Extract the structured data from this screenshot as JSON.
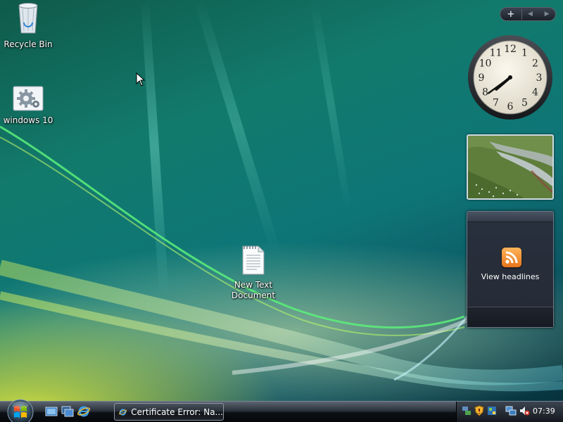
{
  "desktop": {
    "icons": [
      {
        "label": "Recycle Bin",
        "icon": "recycle-bin-icon"
      },
      {
        "label": "windows 10",
        "icon": "settings-shortcut-icon"
      },
      {
        "label": "New Text Document",
        "icon": "text-document-icon"
      }
    ]
  },
  "sidebar": {
    "controls": {
      "add": "+",
      "prev": "◀",
      "next": "▶"
    },
    "clock": {
      "hour": 7,
      "minute": 39,
      "numerals": [
        "12",
        "1",
        "2",
        "3",
        "4",
        "5",
        "6",
        "7",
        "8",
        "9",
        "10",
        "11"
      ]
    },
    "feed": {
      "label": "View headlines",
      "icon": "rss-icon"
    }
  },
  "taskbar": {
    "quick_launch": [
      "show-desktop-icon",
      "switch-windows-icon",
      "internet-explorer-icon"
    ],
    "task": {
      "label": "Certificate Error: Na...",
      "icon": "internet-explorer-icon"
    },
    "tray": {
      "icons": [
        "network-status-icon",
        "security-warning-icon",
        "windows-defender-icon",
        "network-connection-icon",
        "volume-muted-icon"
      ],
      "time": "07:39"
    }
  },
  "colors": {
    "accent": "#0e7577",
    "rss": "#e8741a"
  }
}
